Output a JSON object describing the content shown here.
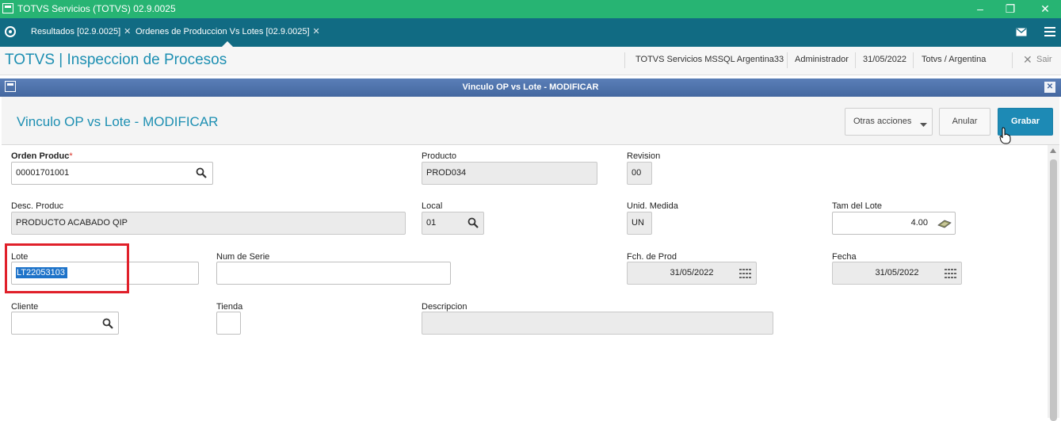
{
  "os_window": {
    "title": "TOTVS Servicios (TOTVS) 02.9.0025"
  },
  "tabs": [
    {
      "label": "Resultados [02.9.0025]",
      "close": "✕"
    },
    {
      "label": "Ordenes de Produccion Vs Lotes [02.9.0025]",
      "close": "✕"
    }
  ],
  "header": {
    "title": "TOTVS | Inspeccion de Procesos",
    "server": "TOTVS Servicios MSSQL Argentina33",
    "user": "Administrador",
    "date": "31/05/2022",
    "company": "Totvs / Argentina",
    "exit_label": "Sair"
  },
  "dialog": {
    "bar_title": "Vinculo OP vs Lote - MODIFICAR",
    "form_title": "Vinculo OP vs Lote - MODIFICAR",
    "buttons": {
      "more_actions": "Otras acciones",
      "cancel": "Anular",
      "save": "Grabar"
    }
  },
  "form": {
    "orden_produc": {
      "label": "Orden Produc",
      "required_mark": "*",
      "value": "00001701001"
    },
    "producto": {
      "label": "Producto",
      "value": "PROD034"
    },
    "revision": {
      "label": "Revision",
      "value": "00"
    },
    "desc_produc": {
      "label": "Desc. Produc",
      "value": "PRODUCTO ACABADO QIP"
    },
    "local": {
      "label": "Local",
      "value": "01"
    },
    "unid_medida": {
      "label": "Unid. Medida",
      "value": "UN"
    },
    "tam_lote": {
      "label": "Tam del Lote",
      "value": "4.00"
    },
    "lote": {
      "label": "Lote",
      "value": "LT22053103"
    },
    "num_serie": {
      "label": "Num de Serie",
      "value": ""
    },
    "fch_prod": {
      "label": "Fch. de Prod",
      "value": "31/05/2022"
    },
    "fecha": {
      "label": "Fecha",
      "value": "31/05/2022"
    },
    "cliente": {
      "label": "Cliente",
      "value": ""
    },
    "tienda": {
      "label": "Tienda",
      "value": ""
    },
    "descripcion": {
      "label": "Descripcion",
      "value": ""
    }
  },
  "icons": {
    "search": "magnifier-icon",
    "calendar": "calendar-icon",
    "calculator": "calculator-icon",
    "mail": "mail-icon",
    "menu": "menu-icon"
  },
  "colors": {
    "os_bar": "#27b473",
    "tab_bar": "#116b83",
    "accent": "#1d8fb2",
    "primary_button": "#1d8ab5",
    "highlight_box": "#e0202a"
  }
}
